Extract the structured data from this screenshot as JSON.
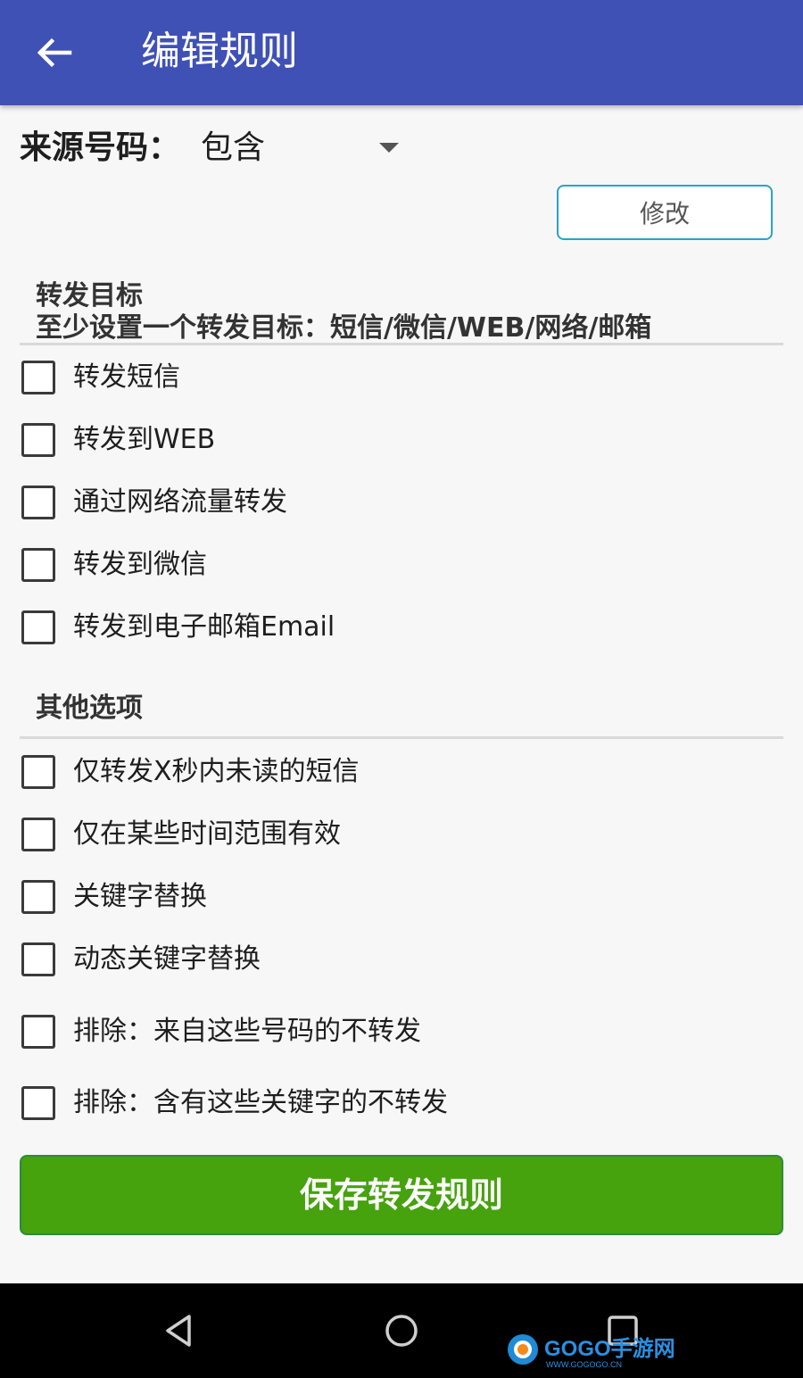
{
  "appbar": {
    "title": "编辑规则",
    "back_icon": "arrow-back-icon",
    "background": "#3f51b5"
  },
  "source": {
    "label": "来源号码：",
    "selected": "包含",
    "modify_label": "修改"
  },
  "targets": {
    "title": "转发目标",
    "subtitle": "至少设置一个转发目标：短信/微信/WEB/网络/邮箱",
    "options": [
      {
        "label": "转发短信",
        "checked": false
      },
      {
        "label": "转发到WEB",
        "checked": false
      },
      {
        "label": "通过网络流量转发",
        "checked": false
      },
      {
        "label": "转发到微信",
        "checked": false
      },
      {
        "label": "转发到电子邮箱Email",
        "checked": false
      }
    ]
  },
  "others": {
    "title": "其他选项",
    "options": [
      {
        "label": "仅转发X秒内未读的短信",
        "checked": false
      },
      {
        "label": "仅在某些时间范围有效",
        "checked": false
      },
      {
        "label": "关键字替换",
        "checked": false
      },
      {
        "label": "动态关键字替换",
        "checked": false
      },
      {
        "label": "排除：来自这些号码的不转发",
        "checked": false
      },
      {
        "label": "排除：含有这些关键字的不转发",
        "checked": false
      }
    ]
  },
  "save_label": "保存转发规则",
  "save_color": "#46a20d",
  "navbar": {
    "icons": [
      "nav-back-icon",
      "nav-home-icon",
      "nav-recents-icon"
    ]
  },
  "watermark": {
    "text": "GOGO手游网",
    "url_text": "WWW.GOGOGO.CN"
  }
}
